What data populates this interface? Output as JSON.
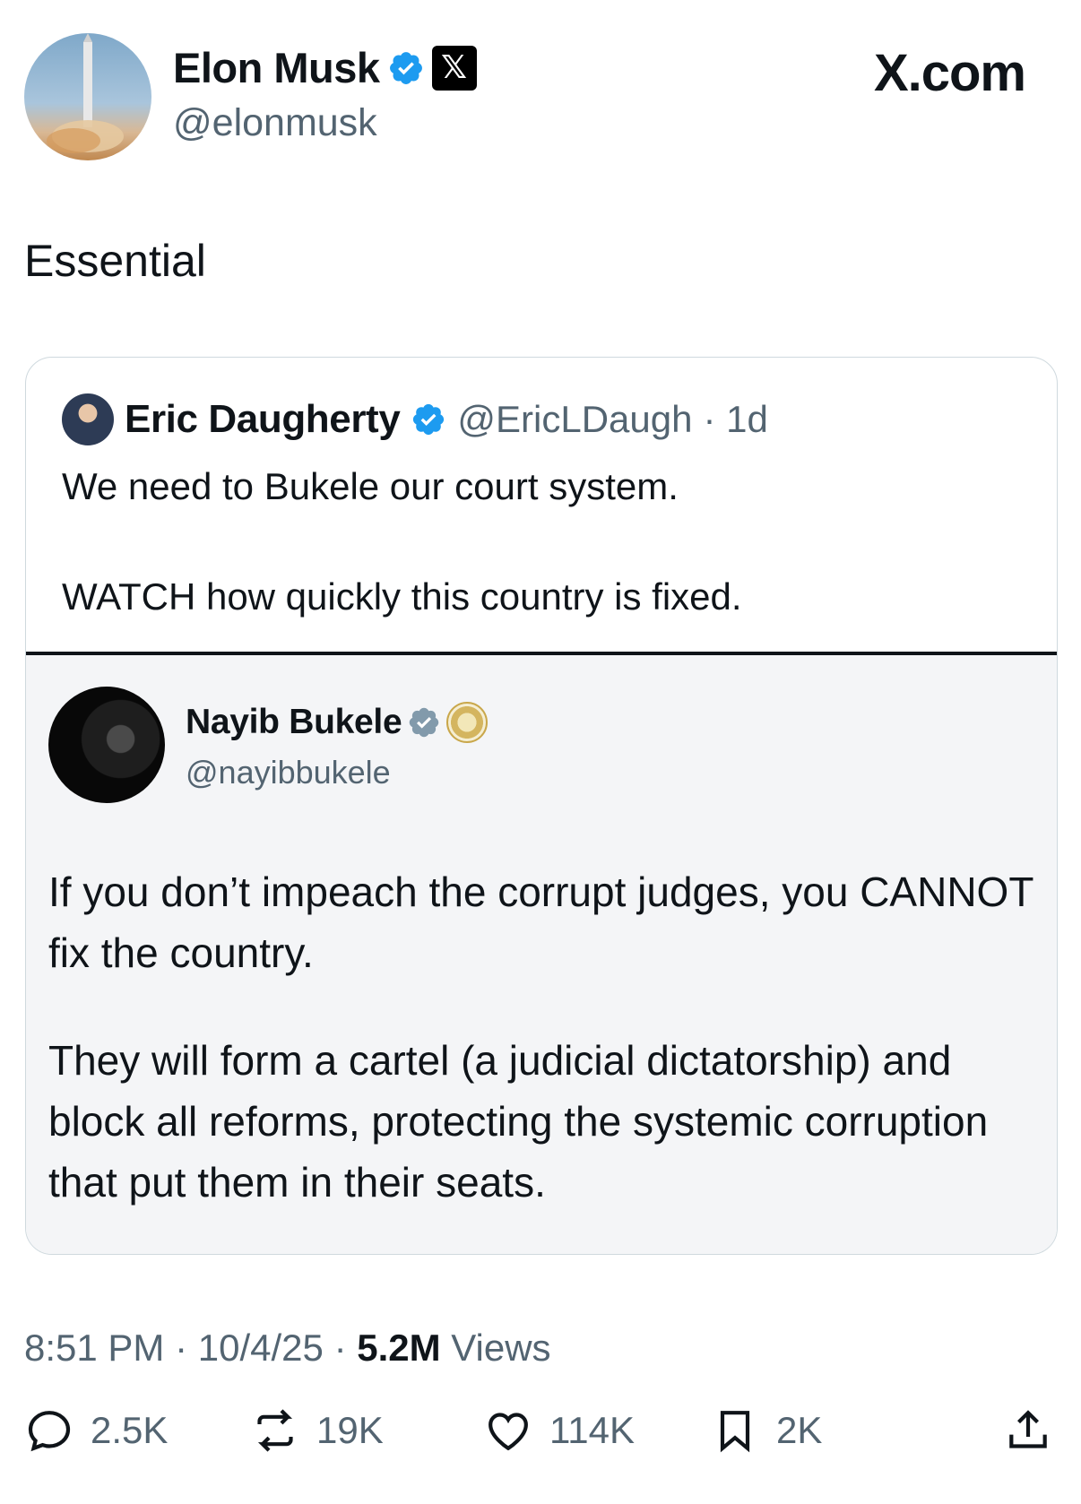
{
  "author": {
    "name": "Elon Musk",
    "handle": "@elonmusk",
    "verified": true,
    "affiliation_badge": "X"
  },
  "brand": "X.com",
  "tweet": {
    "text": "Essential"
  },
  "quoted": {
    "author": {
      "name": "Eric Daugherty",
      "handle": "@EricLDaugh",
      "age": "· 1d"
    },
    "line1": "We need to Bukele our court system.",
    "line2": "WATCH how quickly this country is fixed.",
    "embedded": {
      "author": {
        "name": "Nayib Bukele",
        "handle": "@nayibbukele"
      },
      "paragraph1": "If you don’t impeach the corrupt judges, you CANNOT fix the country.",
      "paragraph2": "They will form a cartel (a judicial dictatorship) and block all reforms, protecting the systemic corruption that put them in their seats."
    }
  },
  "meta": {
    "time": "8:51 PM",
    "date": "10/4/25",
    "views_count": "5.2M",
    "views_label": "Views"
  },
  "actions": {
    "replies": "2.5K",
    "reposts": "19K",
    "likes": "114K",
    "bookmarks": "2K"
  },
  "colors": {
    "verified_blue": "#1d9bf0",
    "secondary_text": "#536471",
    "primary_text": "#0f1419"
  },
  "icons": [
    "verified-badge-icon",
    "x-logo-icon",
    "reply-icon",
    "repost-icon",
    "like-icon",
    "bookmark-icon",
    "share-icon"
  ]
}
